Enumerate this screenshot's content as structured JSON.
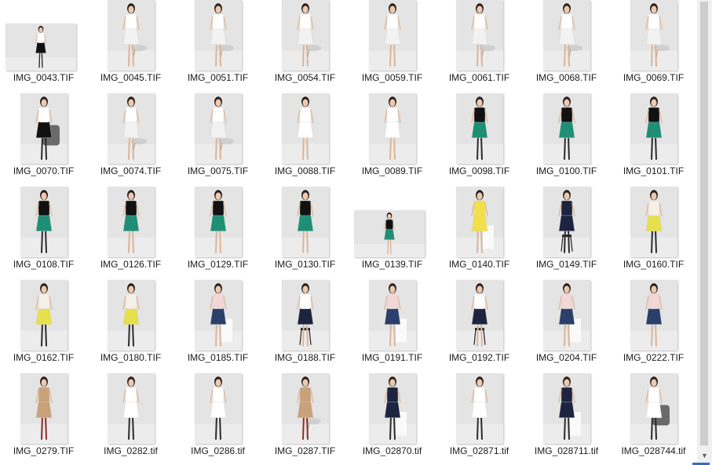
{
  "files": [
    {
      "name": "IMG_0043.TIF",
      "orient": "landscape",
      "top": "#ffffff",
      "bottom": "#111111",
      "seat": "none",
      "legs": "#2a2a2a"
    },
    {
      "name": "IMG_0045.TIF",
      "orient": "portrait",
      "top": "#ffffff",
      "bottom": "#f2f2f2",
      "seat": "chair",
      "legs": "#d9b59a"
    },
    {
      "name": "IMG_0051.TIF",
      "orient": "portrait",
      "top": "#ffffff",
      "bottom": "#f2f2f2",
      "seat": "chair",
      "legs": "#d9b59a"
    },
    {
      "name": "IMG_0054.TIF",
      "orient": "portrait",
      "top": "#ffffff",
      "bottom": "#f2f2f2",
      "seat": "chair",
      "legs": "#d9b59a"
    },
    {
      "name": "IMG_0059.TIF",
      "orient": "portrait",
      "top": "#ffffff",
      "bottom": "#f2f2f2",
      "seat": "none",
      "legs": "#d9b59a"
    },
    {
      "name": "IMG_0061.TIF",
      "orient": "portrait",
      "top": "#ffffff",
      "bottom": "#f2f2f2",
      "seat": "chair",
      "legs": "#d9b59a"
    },
    {
      "name": "IMG_0068.TIF",
      "orient": "portrait",
      "top": "#ffffff",
      "bottom": "#f2f2f2",
      "seat": "chair",
      "legs": "#d9b59a"
    },
    {
      "name": "IMG_0069.TIF",
      "orient": "portrait",
      "top": "#ffffff",
      "bottom": "#f2f2f2",
      "seat": "chair",
      "legs": "#d9b59a"
    },
    {
      "name": "IMG_0070.TIF",
      "orient": "portrait",
      "top": "#ffffff",
      "bottom": "#111111",
      "seat": "armchair",
      "legs": "#2a2a2a"
    },
    {
      "name": "IMG_0074.TIF",
      "orient": "portrait",
      "top": "#ffffff",
      "bottom": "#f2f2f2",
      "seat": "chair",
      "legs": "#d9b59a"
    },
    {
      "name": "IMG_0075.TIF",
      "orient": "portrait",
      "top": "#ffffff",
      "bottom": "#f2f2f2",
      "seat": "chair",
      "legs": "#d9b59a"
    },
    {
      "name": "IMG_0088.TIF",
      "orient": "portrait",
      "top": "#ffffff",
      "bottom": "#ffffff",
      "seat": "none",
      "legs": "#d9b59a"
    },
    {
      "name": "IMG_0089.TIF",
      "orient": "portrait",
      "top": "#ffffff",
      "bottom": "#ffffff",
      "seat": "none",
      "legs": "#d9b59a"
    },
    {
      "name": "IMG_0098.TIF",
      "orient": "portrait",
      "top": "#111111",
      "bottom": "#1e8f74",
      "seat": "none",
      "legs": "#2a2a2a"
    },
    {
      "name": "IMG_0100.TIF",
      "orient": "portrait",
      "top": "#111111",
      "bottom": "#1e8f74",
      "seat": "none",
      "legs": "#2a2a2a"
    },
    {
      "name": "IMG_0101.TIF",
      "orient": "portrait",
      "top": "#111111",
      "bottom": "#1e8f74",
      "seat": "none",
      "legs": "#2a2a2a"
    },
    {
      "name": "IMG_0108.TIF",
      "orient": "portrait",
      "top": "#111111",
      "bottom": "#1e8f74",
      "seat": "none",
      "legs": "#2a2a2a"
    },
    {
      "name": "IMG_0126.TIF",
      "orient": "portrait",
      "top": "#111111",
      "bottom": "#1e8f74",
      "seat": "none",
      "legs": "#d9b59a"
    },
    {
      "name": "IMG_0129.TIF",
      "orient": "portrait",
      "top": "#111111",
      "bottom": "#1e8f74",
      "seat": "none",
      "legs": "#d9b59a"
    },
    {
      "name": "IMG_0130.TIF",
      "orient": "portrait",
      "top": "#111111",
      "bottom": "#1e8f74",
      "seat": "none",
      "legs": "#d9b59a"
    },
    {
      "name": "IMG_0139.TIF",
      "orient": "landscape",
      "top": "#111111",
      "bottom": "#1e8f74",
      "seat": "none",
      "legs": "#d9b59a"
    },
    {
      "name": "IMG_0140.TIF",
      "orient": "portrait",
      "top": "#f2e04a",
      "bottom": "#f2e04a",
      "seat": "block",
      "legs": "#d9b59a"
    },
    {
      "name": "IMG_0149.TIF",
      "orient": "portrait",
      "top": "#1c2440",
      "bottom": "#1c2440",
      "seat": "stool",
      "legs": "#2a2a2a"
    },
    {
      "name": "IMG_0160.TIF",
      "orient": "portrait",
      "top": "#f5f0e8",
      "bottom": "#e6e04a",
      "seat": "none",
      "legs": "#2a2a2a"
    },
    {
      "name": "IMG_0162.TIF",
      "orient": "portrait",
      "top": "#f5f0e8",
      "bottom": "#e6e04a",
      "seat": "none",
      "legs": "#2a2a2a"
    },
    {
      "name": "IMG_0180.TIF",
      "orient": "portrait",
      "top": "#f5f0e8",
      "bottom": "#e6e04a",
      "seat": "none",
      "legs": "#2a2a2a"
    },
    {
      "name": "IMG_0185.TIF",
      "orient": "portrait",
      "top": "#f3d6d6",
      "bottom": "#2a3f6a",
      "seat": "block",
      "legs": "#d9b59a"
    },
    {
      "name": "IMG_0188.TIF",
      "orient": "portrait",
      "top": "#ffffff",
      "bottom": "#1c2440",
      "seat": "stool",
      "legs": "#d9b59a"
    },
    {
      "name": "IMG_0191.TIF",
      "orient": "portrait",
      "top": "#f3d6d6",
      "bottom": "#2a3f6a",
      "seat": "block",
      "legs": "#d9b59a"
    },
    {
      "name": "IMG_0192.TIF",
      "orient": "portrait",
      "top": "#ffffff",
      "bottom": "#1c2440",
      "seat": "stool",
      "legs": "#d9b59a"
    },
    {
      "name": "IMG_0204.TIF",
      "orient": "portrait",
      "top": "#f3d6d6",
      "bottom": "#2a3f6a",
      "seat": "block",
      "legs": "#d9b59a"
    },
    {
      "name": "IMG_0222.TIF",
      "orient": "portrait",
      "top": "#f3d6d6",
      "bottom": "#2a3f6a",
      "seat": "none",
      "legs": "#d9b59a"
    },
    {
      "name": "IMG_0279.TIF",
      "orient": "portrait",
      "top": "#c9a27a",
      "bottom": "#c9a27a",
      "seat": "none",
      "legs": "#8a2a2a"
    },
    {
      "name": "IMG_0282.tif",
      "orient": "portrait",
      "top": "#ffffff",
      "bottom": "#ffffff",
      "seat": "none",
      "legs": "#2a2a2a"
    },
    {
      "name": "IMG_0286.tif",
      "orient": "portrait",
      "top": "#ffffff",
      "bottom": "#ffffff",
      "seat": "none",
      "legs": "#2a2a2a"
    },
    {
      "name": "IMG_0287.TIF",
      "orient": "portrait",
      "top": "#c9a27a",
      "bottom": "#c9a27a",
      "seat": "chair",
      "legs": "#8a2a2a"
    },
    {
      "name": "IMG_02870.tif",
      "orient": "portrait",
      "top": "#1c2440",
      "bottom": "#1c2440",
      "seat": "block",
      "legs": "#2a2a2a"
    },
    {
      "name": "IMG_02871.tif",
      "orient": "portrait",
      "top": "#ffffff",
      "bottom": "#ffffff",
      "seat": "none",
      "legs": "#2a2a2a"
    },
    {
      "name": "IMG_028711.tif",
      "orient": "portrait",
      "top": "#1c2440",
      "bottom": "#1c2440",
      "seat": "block",
      "legs": "#2a2a2a"
    },
    {
      "name": "IMG_028744.tif",
      "orient": "portrait",
      "top": "#ffffff",
      "bottom": "#ffffff",
      "seat": "armchair",
      "legs": "#2a2a2a"
    }
  ],
  "scrollbar": {
    "down_arrow": "▼"
  }
}
